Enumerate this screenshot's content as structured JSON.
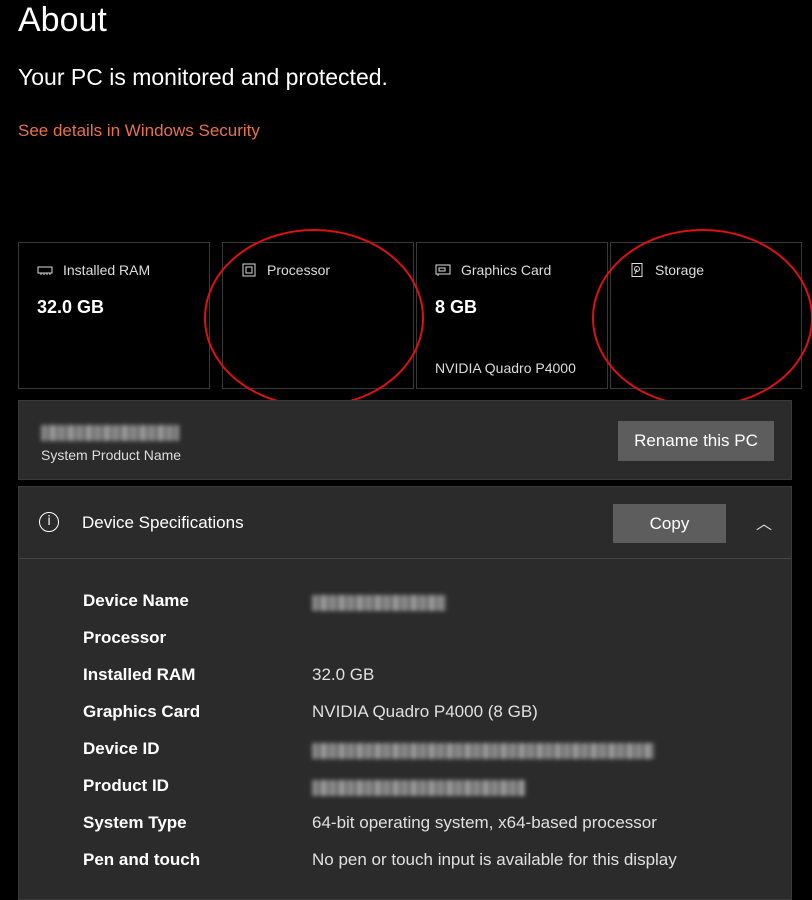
{
  "page": {
    "title": "About",
    "status": "Your PC is monitored and protected.",
    "security_link": "See details in Windows Security"
  },
  "cards": [
    {
      "label": "Installed RAM",
      "value": "32.0 GB",
      "sub": "",
      "icon": "memory-icon"
    },
    {
      "label": "Processor",
      "value": "",
      "sub": "",
      "icon": "processor-icon"
    },
    {
      "label": "Graphics Card",
      "value": "8 GB",
      "sub": "NVIDIA Quadro P4000",
      "icon": "graphics-card-icon"
    },
    {
      "label": "Storage",
      "value": "",
      "sub": "",
      "icon": "storage-icon"
    }
  ],
  "rename": {
    "system_product_label": "System Product Name",
    "button_label": "Rename this PC"
  },
  "specs": {
    "title": "Device Specifications",
    "copy_label": "Copy",
    "rows": [
      {
        "key": "Device Name",
        "value": ""
      },
      {
        "key": "Processor",
        "value": ""
      },
      {
        "key": "Installed RAM",
        "value": "32.0 GB"
      },
      {
        "key": "Graphics Card",
        "value": "NVIDIA Quadro P4000 (8 GB)"
      },
      {
        "key": "Device ID",
        "value": ""
      },
      {
        "key": "Product ID",
        "value": ""
      },
      {
        "key": "System Type",
        "value": "64-bit operating system, x64-based processor"
      },
      {
        "key": "Pen and touch",
        "value": "No pen or touch input is available for this display"
      }
    ]
  },
  "colors": {
    "link": "#e8734a",
    "annotation_ring": "#dd1111",
    "panel": "#2b2b2b",
    "button": "#5d5d5d"
  }
}
